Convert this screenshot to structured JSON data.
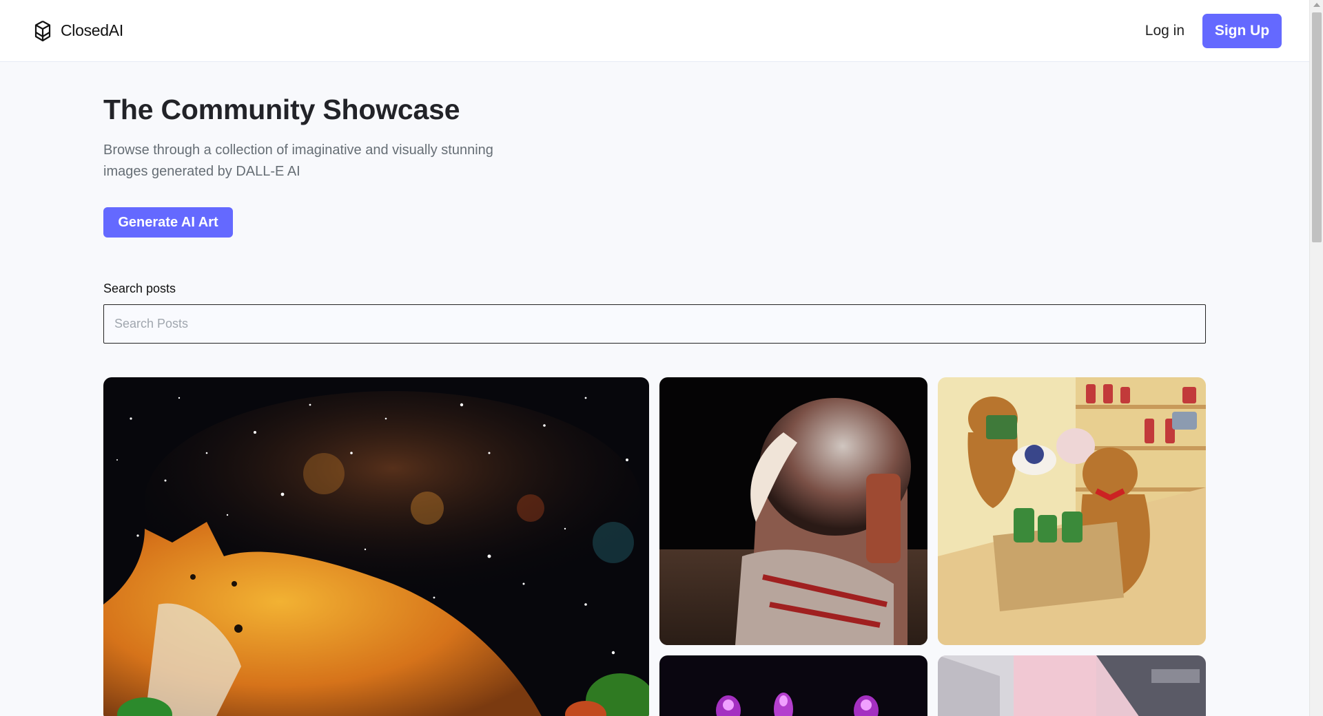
{
  "app": {
    "brand_name": "ClosedAI",
    "brand_icon": "openai-knot-icon",
    "accent_color": "#6469ff"
  },
  "header": {
    "login_label": "Log in",
    "signup_label": "Sign Up"
  },
  "loading_bar": {
    "progress": 0.2
  },
  "hero": {
    "title": "The Community Showcase",
    "subtitle": "Browse through a collection of imaginative and visually stunning images generated by DALL-E AI",
    "cta_label": "Generate AI Art"
  },
  "search": {
    "label": "Search posts",
    "placeholder": "Search Posts",
    "value": ""
  },
  "gallery": {
    "items": [
      {
        "subject": "fox-in-space-painting"
      },
      {
        "subject": "astronaut-on-moon"
      },
      {
        "subject": "teddy-bears-grocery-shopping"
      },
      {
        "subject": "neon-figures"
      },
      {
        "subject": "pink-interior-room"
      }
    ]
  }
}
